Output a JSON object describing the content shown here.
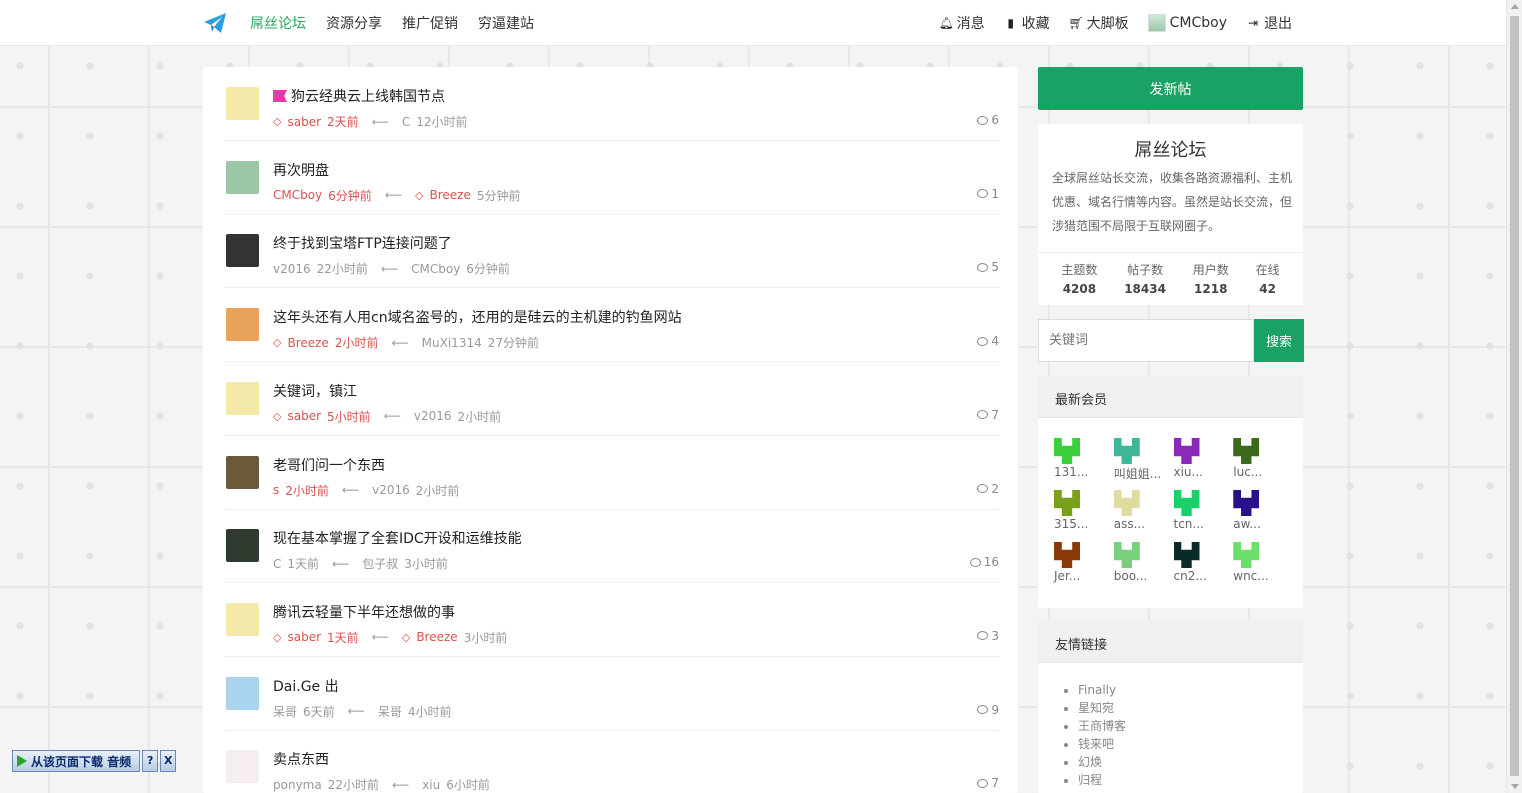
{
  "nav": {
    "links": [
      "屌丝论坛",
      "资源分享",
      "推广促销",
      "穷逼建站"
    ],
    "right": [
      {
        "icon": "bell-icon",
        "label": "消息"
      },
      {
        "icon": "bookmark-icon",
        "label": "收藏"
      },
      {
        "icon": "cart-icon",
        "label": "大脚板"
      },
      {
        "icon": "user-avatar",
        "label": "CMCboy"
      },
      {
        "icon": "logout-icon",
        "label": "退出"
      }
    ]
  },
  "topics": [
    {
      "title": "狗云经典云上线韩国节点",
      "flag": true,
      "author": "saber",
      "author_gem": true,
      "time": "2天前",
      "last": "C",
      "last_gem": false,
      "last_time": "12小时前",
      "count": "6",
      "avatar_color": "#f3e9a8"
    },
    {
      "title": "再次明盘",
      "flag": false,
      "author": "CMCboy",
      "author_red": true,
      "author_gem": false,
      "time": "6分钟前",
      "last": "Breeze",
      "last_gem": true,
      "last_time": "5分钟前",
      "count": "1",
      "avatar_color": "#9bc7a7"
    },
    {
      "title": "终于找到宝塔FTP连接问题了",
      "flag": false,
      "author": "v2016",
      "author_gem": false,
      "time": "22小时前",
      "last": "CMCboy",
      "last_gem": false,
      "last_time": "6分钟前",
      "count": "5",
      "avatar_color": "#333333"
    },
    {
      "title": "这年头还有人用cn域名盗号的，还用的是硅云的主机建的钓鱼网站",
      "flag": false,
      "author": "Breeze",
      "author_gem": true,
      "time": "2小时前",
      "last": "MuXi1314",
      "last_gem": false,
      "last_time": "27分钟前",
      "count": "4",
      "avatar_color": "#e8a25a"
    },
    {
      "title": "关键词，镇江",
      "flag": false,
      "author": "saber",
      "author_gem": true,
      "time": "5小时前",
      "last": "v2016",
      "last_gem": false,
      "last_time": "2小时前",
      "count": "7",
      "avatar_color": "#f3e9a8"
    },
    {
      "title": "老哥们问一个东西",
      "flag": false,
      "author": "s",
      "author_red": true,
      "author_gem": false,
      "time": "2小时前",
      "last": "v2016",
      "last_gem": false,
      "last_time": "2小时前",
      "count": "2",
      "avatar_color": "#6a5a3a"
    },
    {
      "title": "现在基本掌握了全套IDC开设和运维技能",
      "flag": false,
      "author": "C",
      "author_gem": false,
      "time": "1天前",
      "last": "包子叔",
      "last_gem": false,
      "last_time": "3小时前",
      "count": "16",
      "avatar_color": "#2f3b2f"
    },
    {
      "title": "腾讯云轻量下半年还想做的事",
      "flag": false,
      "author": "saber",
      "author_gem": true,
      "time": "1天前",
      "last": "Breeze",
      "last_gem": true,
      "last_time": "3小时前",
      "count": "3",
      "avatar_color": "#f3e9a8"
    },
    {
      "title": "Dai.Ge 出",
      "flag": false,
      "author": "呆哥",
      "author_gem": false,
      "time": "6天前",
      "last": "呆哥",
      "last_gem": false,
      "last_time": "4小时前",
      "count": "9",
      "avatar_color": "#a8d4f0"
    },
    {
      "title": "卖点东西",
      "flag": false,
      "author": "ponyma",
      "author_gem": false,
      "time": "22小时前",
      "last": "xiu",
      "last_gem": false,
      "last_time": "6小时前",
      "count": "7",
      "avatar_color": "#f6eeee"
    }
  ],
  "sidebar": {
    "new_post": "发新帖",
    "forum_name": "屌丝论坛",
    "forum_desc": "全球屌丝站长交流，收集各路资源福利、主机优惠、域名行情等内容。虽然是站长交流，但涉猎范围不局限于互联网圈子。",
    "stats": [
      {
        "label": "主题数",
        "value": "4208"
      },
      {
        "label": "帖子数",
        "value": "18434"
      },
      {
        "label": "用户数",
        "value": "1218"
      },
      {
        "label": "在线",
        "value": "42"
      }
    ],
    "search_placeholder": "关键词",
    "search_button": "搜索",
    "members_title": "最新会员",
    "members": [
      {
        "name": "131...",
        "color": "#3ccf3c"
      },
      {
        "name": "叫姐姐...",
        "color": "#3fb89a"
      },
      {
        "name": "xiu...",
        "color": "#8a2ab8"
      },
      {
        "name": "luc...",
        "color": "#3a6a1a"
      },
      {
        "name": "315...",
        "color": "#7aa01a"
      },
      {
        "name": "ass...",
        "color": "#e0dca0"
      },
      {
        "name": "tcn...",
        "color": "#1ad06a"
      },
      {
        "name": "aw...",
        "color": "#2a108a"
      },
      {
        "name": "Jer...",
        "color": "#8a3a0a"
      },
      {
        "name": "boo...",
        "color": "#7ad07a"
      },
      {
        "name": "cn2...",
        "color": "#0a2a2a"
      },
      {
        "name": "wnc...",
        "color": "#6ae06a"
      }
    ],
    "links_title": "友情链接",
    "links": [
      "Finally",
      "星知宛",
      "王商博客",
      "钱来吧",
      "幻焕",
      "归程"
    ]
  },
  "download_bar": {
    "label": "从该页面下载 音频",
    "help": "?",
    "close": "X"
  }
}
